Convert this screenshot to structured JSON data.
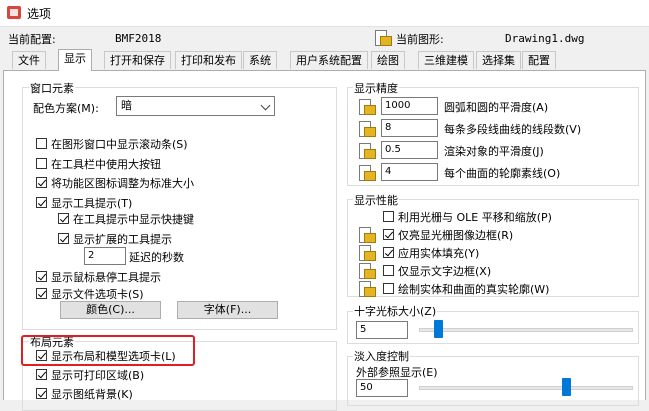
{
  "window": {
    "title": "选项"
  },
  "profile_row": {
    "current_config_label": "当前配置:",
    "current_config_value": "BMF2018",
    "current_drawing_label": "当前图形:",
    "current_drawing_value": "Drawing1.dwg"
  },
  "tabs": [
    {
      "label": "文件"
    },
    {
      "label": "显示",
      "selected": true
    },
    {
      "label": "打开和保存"
    },
    {
      "label": "打印和发布"
    },
    {
      "label": "系统"
    },
    {
      "label": "用户系统配置"
    },
    {
      "label": "绘图"
    },
    {
      "label": "三维建模"
    },
    {
      "label": "选择集"
    },
    {
      "label": "配置"
    }
  ],
  "window_elements": {
    "title": "窗口元素",
    "color_scheme_label": "配色方案(M):",
    "color_scheme_value": "暗",
    "options": [
      {
        "label": "在图形窗口中显示滚动条(S)",
        "checked": false
      },
      {
        "label": "在工具栏中使用大按钮",
        "checked": false
      },
      {
        "label": "将功能区图标调整为标准大小",
        "checked": true
      },
      {
        "label": "显示工具提示(T)",
        "checked": true
      },
      {
        "label": "在工具提示中显示快捷键",
        "checked": true
      },
      {
        "label": "显示扩展的工具提示",
        "checked": true
      },
      {
        "label": "显示鼠标悬停工具提示",
        "checked": true
      },
      {
        "label": "显示文件选项卡(S)",
        "checked": true
      }
    ],
    "delay_value": "2",
    "delay_label": "延迟的秒数",
    "color_button": "颜色(C)...",
    "font_button": "字体(F)..."
  },
  "layout_elements": {
    "title": "布局元素",
    "options": [
      {
        "label": "显示布局和模型选项卡(L)",
        "checked": true
      },
      {
        "label": "显示可打印区域(B)",
        "checked": true
      },
      {
        "label": "显示图纸背景(K)",
        "checked": true
      }
    ]
  },
  "display_resolution": {
    "title": "显示精度",
    "items": [
      {
        "value": "1000",
        "label": "圆弧和圆的平滑度(A)"
      },
      {
        "value": "8",
        "label": "每条多段线曲线的线段数(V)"
      },
      {
        "value": "0.5",
        "label": "渲染对象的平滑度(J)"
      },
      {
        "value": "4",
        "label": "每个曲面的轮廓素线(O)"
      }
    ]
  },
  "display_performance": {
    "title": "显示性能",
    "options": [
      {
        "label": "利用光栅与 OLE 平移和缩放(P)",
        "checked": false,
        "icon": false
      },
      {
        "label": "仅亮显光栅图像边框(R)",
        "checked": true,
        "icon": true
      },
      {
        "label": "应用实体填充(Y)",
        "checked": true,
        "icon": true
      },
      {
        "label": "仅显示文字边框(X)",
        "checked": false,
        "icon": true
      },
      {
        "label": "绘制实体和曲面的真实轮廓(W)",
        "checked": false,
        "icon": true
      }
    ]
  },
  "crosshair": {
    "title": "十字光标大小(Z)",
    "value": "5",
    "level_percent": 5
  },
  "fade": {
    "title": "淡入度控制",
    "xref_label": "外部参照显示(E)",
    "xref_value": "50",
    "level_percent": 50
  },
  "colors": {
    "highlight": "#e02020",
    "accent": "#0078d7"
  }
}
